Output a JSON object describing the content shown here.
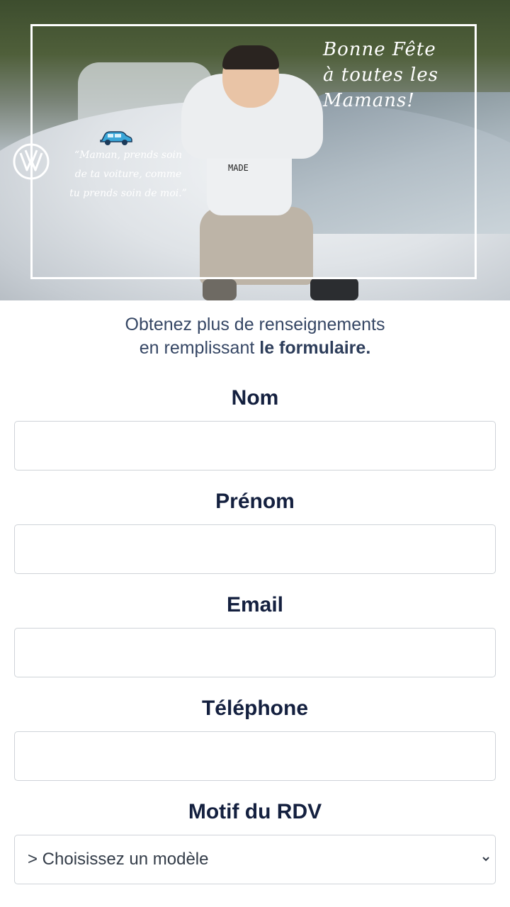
{
  "hero": {
    "title_line1": "Bonne Fête",
    "title_line2": "à toutes les",
    "title_line3": "Mamans!",
    "quote_line1": "“Maman, prends soin",
    "quote_line2": "de ta voiture, comme",
    "quote_line3": "tu prends soin de moi.”",
    "logo": "vw-logo",
    "shirt_text": "MADE"
  },
  "intro": {
    "line1": "Obtenez plus de renseignements",
    "line2_prefix": "en remplissant ",
    "line2_bold": "le formulaire."
  },
  "form": {
    "nom_label": "Nom",
    "nom_value": "",
    "prenom_label": "Prénom",
    "prenom_value": "",
    "email_label": "Email",
    "email_value": "",
    "telephone_label": "Téléphone",
    "telephone_value": "",
    "motif_label": "Motif du RDV",
    "motif_selected": "> Choisissez un modèle"
  },
  "colors": {
    "heading": "#14203f",
    "intro_text": "#354664",
    "field_border": "#cfd3d8"
  }
}
